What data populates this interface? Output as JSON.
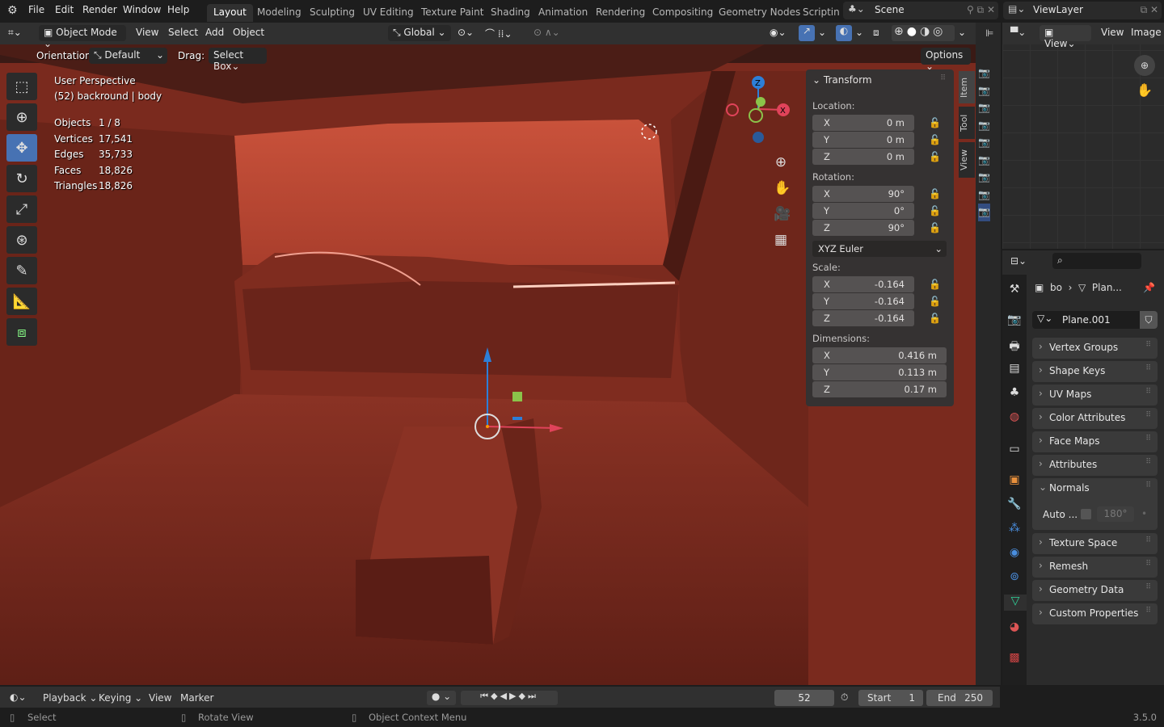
{
  "menu": [
    "File",
    "Edit",
    "Render",
    "Window",
    "Help"
  ],
  "workspaces": [
    "Layout",
    "Modeling",
    "Sculpting",
    "UV Editing",
    "Texture Paint",
    "Shading",
    "Animation",
    "Rendering",
    "Compositing",
    "Geometry Nodes",
    "Scripting"
  ],
  "active_workspace": "Layout",
  "scene": "Scene",
  "view_layer": "ViewLayer",
  "viewport_header": {
    "mode": "Object Mode",
    "menus": [
      "View",
      "Select",
      "Add",
      "Object"
    ],
    "orientation_global": "Global"
  },
  "tool_settings": {
    "orientation_label": "Orientation:",
    "orientation": "Default",
    "drag_label": "Drag:",
    "drag": "Select Box",
    "options": "Options"
  },
  "overlay": {
    "perspective": "User Perspective",
    "object": "(52) backround | body",
    "stats": [
      {
        "k": "Objects",
        "v": "1 / 8"
      },
      {
        "k": "Vertices",
        "v": "17,541"
      },
      {
        "k": "Edges",
        "v": "35,733"
      },
      {
        "k": "Faces",
        "v": "18,826"
      },
      {
        "k": "Triangles",
        "v": "18,826"
      }
    ]
  },
  "transform": {
    "title": "Transform",
    "location_label": "Location:",
    "location": [
      "0 m",
      "0 m",
      "0 m"
    ],
    "rotation_label": "Rotation:",
    "rotation": [
      "90°",
      "0°",
      "90°"
    ],
    "rotation_mode": "XYZ Euler",
    "scale_label": "Scale:",
    "scale": [
      "-0.164",
      "-0.164",
      "-0.164"
    ],
    "dimensions_label": "Dimensions:",
    "dimensions": [
      "0.416 m",
      "0.113 m",
      "0.17 m"
    ],
    "axes": [
      "X",
      "Y",
      "Z"
    ]
  },
  "sidebar_tabs": [
    "Item",
    "Tool",
    "View"
  ],
  "image_editor": {
    "view1": "View",
    "view2": "View",
    "image": "Image"
  },
  "properties": {
    "breadcrumb_object": "bo",
    "breadcrumb_data": "Plan...",
    "mesh_name": "Plane.001",
    "panels": [
      "Vertex Groups",
      "Shape Keys",
      "UV Maps",
      "Color Attributes",
      "Face Maps",
      "Attributes"
    ],
    "normals": {
      "title": "Normals",
      "auto_label": "Auto ...",
      "angle": "180°"
    },
    "panels2": [
      "Texture Space",
      "Remesh",
      "Geometry Data",
      "Custom Properties"
    ]
  },
  "timeline": {
    "menus": [
      "Playback",
      "Keying",
      "View",
      "Marker"
    ],
    "current_frame": "52",
    "start_label": "Start",
    "start": "1",
    "end_label": "End",
    "end": "250"
  },
  "status": {
    "select": "Select",
    "rotate": "Rotate View",
    "context": "Object Context Menu",
    "version": "3.5.0"
  },
  "colors": {
    "accent": "#4772b3",
    "axis_x": "#e0435a",
    "axis_y": "#8bc34a",
    "axis_z": "#2d7fd8",
    "mesh_tab": "#2fd49a"
  }
}
